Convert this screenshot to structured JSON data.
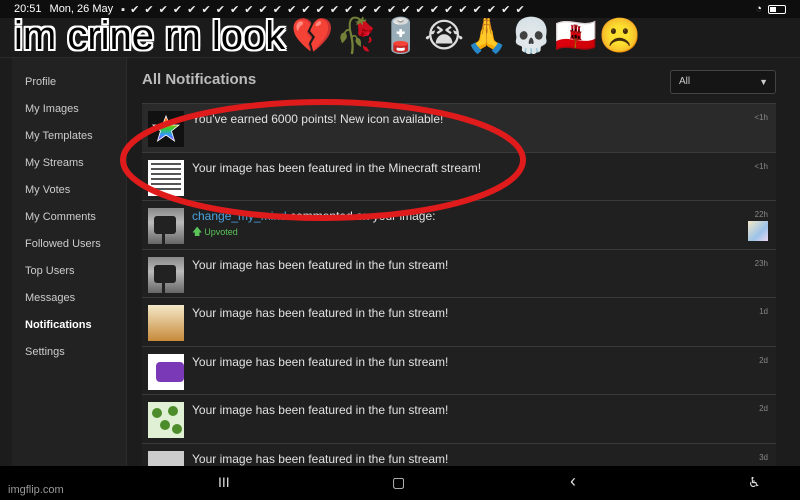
{
  "status_bar": {
    "time": "20:51",
    "date": "Mon, 26 May",
    "checks": "▪ ✔ ✔ ✔ ✔ ✔ ✔ ✔ ✔ ✔ ✔ ✔ ✔ ✔ ✔ ✔ ✔ ✔ ✔ ✔ ✔ ✔ ✔ ✔ ✔ ✔ ✔ ✔ ✔"
  },
  "caption": {
    "text": "im crine rn look",
    "emojis": "💔🥀🪫😭🙏💀🇬🇮☹️"
  },
  "sidebar": {
    "items": [
      {
        "label": "Profile"
      },
      {
        "label": "My Images"
      },
      {
        "label": "My Templates"
      },
      {
        "label": "My Streams"
      },
      {
        "label": "My Votes"
      },
      {
        "label": "My Comments"
      },
      {
        "label": "Followed Users"
      },
      {
        "label": "Top Users"
      },
      {
        "label": "Messages"
      },
      {
        "label": "Notifications"
      },
      {
        "label": "Settings"
      }
    ]
  },
  "main": {
    "title": "All Notifications",
    "filter_value": "All",
    "notifications": [
      {
        "text": "You've earned 6000 points! New icon available!",
        "time": "<1h"
      },
      {
        "text": "Your image has been featured in the Minecraft stream!",
        "time": "<1h"
      },
      {
        "user": "change_my_mind",
        "text": " commented on your image:",
        "time": "22h",
        "upvote": "Upvoted"
      },
      {
        "text": "Your image has been featured in the fun stream!",
        "time": "23h"
      },
      {
        "text": "Your image has been featured in the fun stream!",
        "time": "1d"
      },
      {
        "text": "Your image has been featured in the fun stream!",
        "time": "2d"
      },
      {
        "text": "Your image has been featured in the fun stream!",
        "time": "2d"
      },
      {
        "text": "Your image has been featured in the fun stream!",
        "time": "3d"
      }
    ]
  },
  "navbar": {
    "recents": "III",
    "home": "▢",
    "back": "‹",
    "accessibility": "♿"
  },
  "watermark": "imgflip.com",
  "colors": {
    "accent_red": "#e01b1b",
    "link_blue": "#4aa3df",
    "upvote_green": "#5ac45a"
  }
}
